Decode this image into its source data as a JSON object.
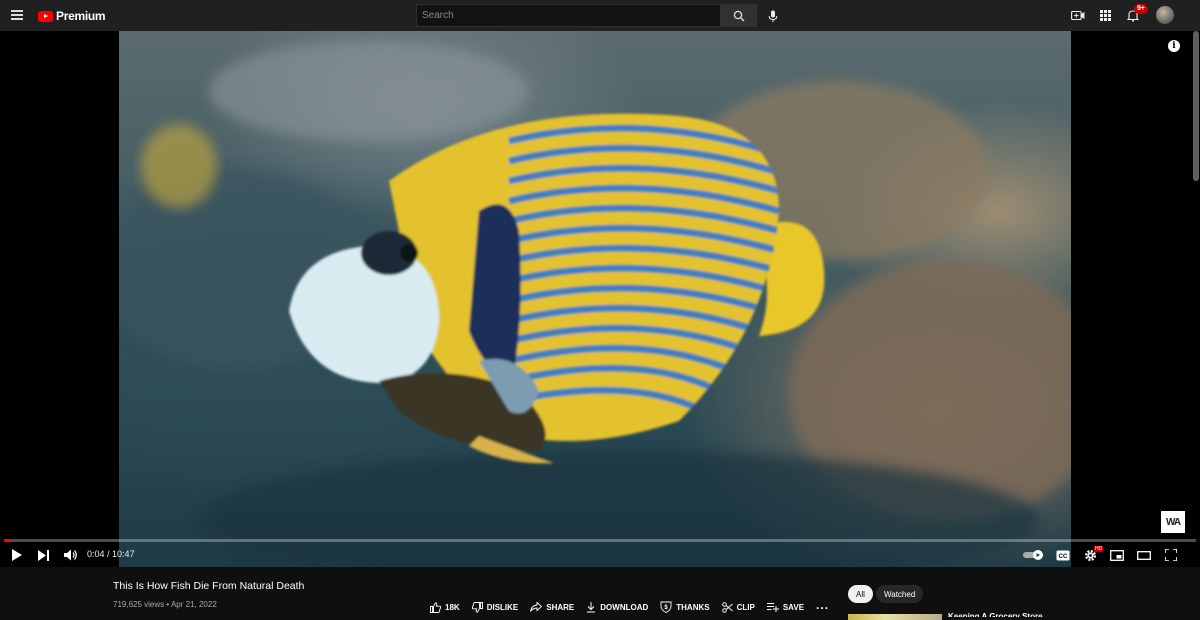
{
  "header": {
    "logo_text": "Premium",
    "search_placeholder": "Search",
    "notification_count": "9+"
  },
  "player": {
    "watermark": "WA",
    "info_glyph": "i",
    "time_current": "0:04",
    "time_separator": " / ",
    "time_total": "10:47",
    "progress_fraction": 0.006,
    "hd_badge": "HD"
  },
  "video_info": {
    "title": "This Is How Fish Die From Natural Death",
    "views": "719,625 views",
    "separator": " • ",
    "date": "Apr 21, 2022"
  },
  "actions": [
    {
      "label": "18K",
      "icon": "thumbs-up-icon"
    },
    {
      "label": "DISLIKE",
      "icon": "thumbs-down-icon"
    },
    {
      "label": "SHARE",
      "icon": "share-icon"
    },
    {
      "label": "DOWNLOAD",
      "icon": "download-icon"
    },
    {
      "label": "THANKS",
      "icon": "thanks-icon"
    },
    {
      "label": "CLIP",
      "icon": "scissors-icon"
    },
    {
      "label": "SAVE",
      "icon": "playlist-add-icon"
    },
    {
      "label": "...",
      "icon": "more-icon"
    }
  ],
  "sidebar": {
    "chips": [
      "All",
      "Watched"
    ],
    "recommendation_title": "Keeping A Grocery Store"
  },
  "colors": {
    "accent": "#ff0000",
    "background": "#0f0f0f",
    "topbar": "#202020"
  }
}
